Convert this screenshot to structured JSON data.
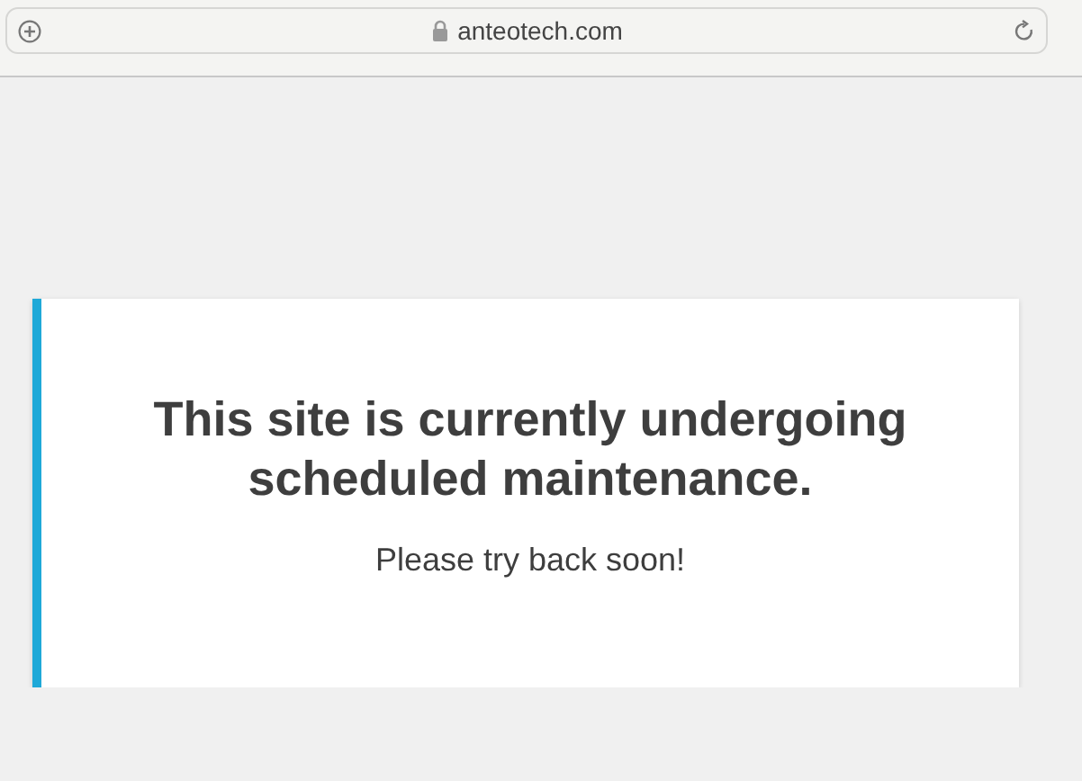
{
  "browser": {
    "address": "anteotech.com",
    "secure": true
  },
  "notice": {
    "title": "This site is currently undergoing scheduled maintenance.",
    "message": "Please try back soon!"
  }
}
